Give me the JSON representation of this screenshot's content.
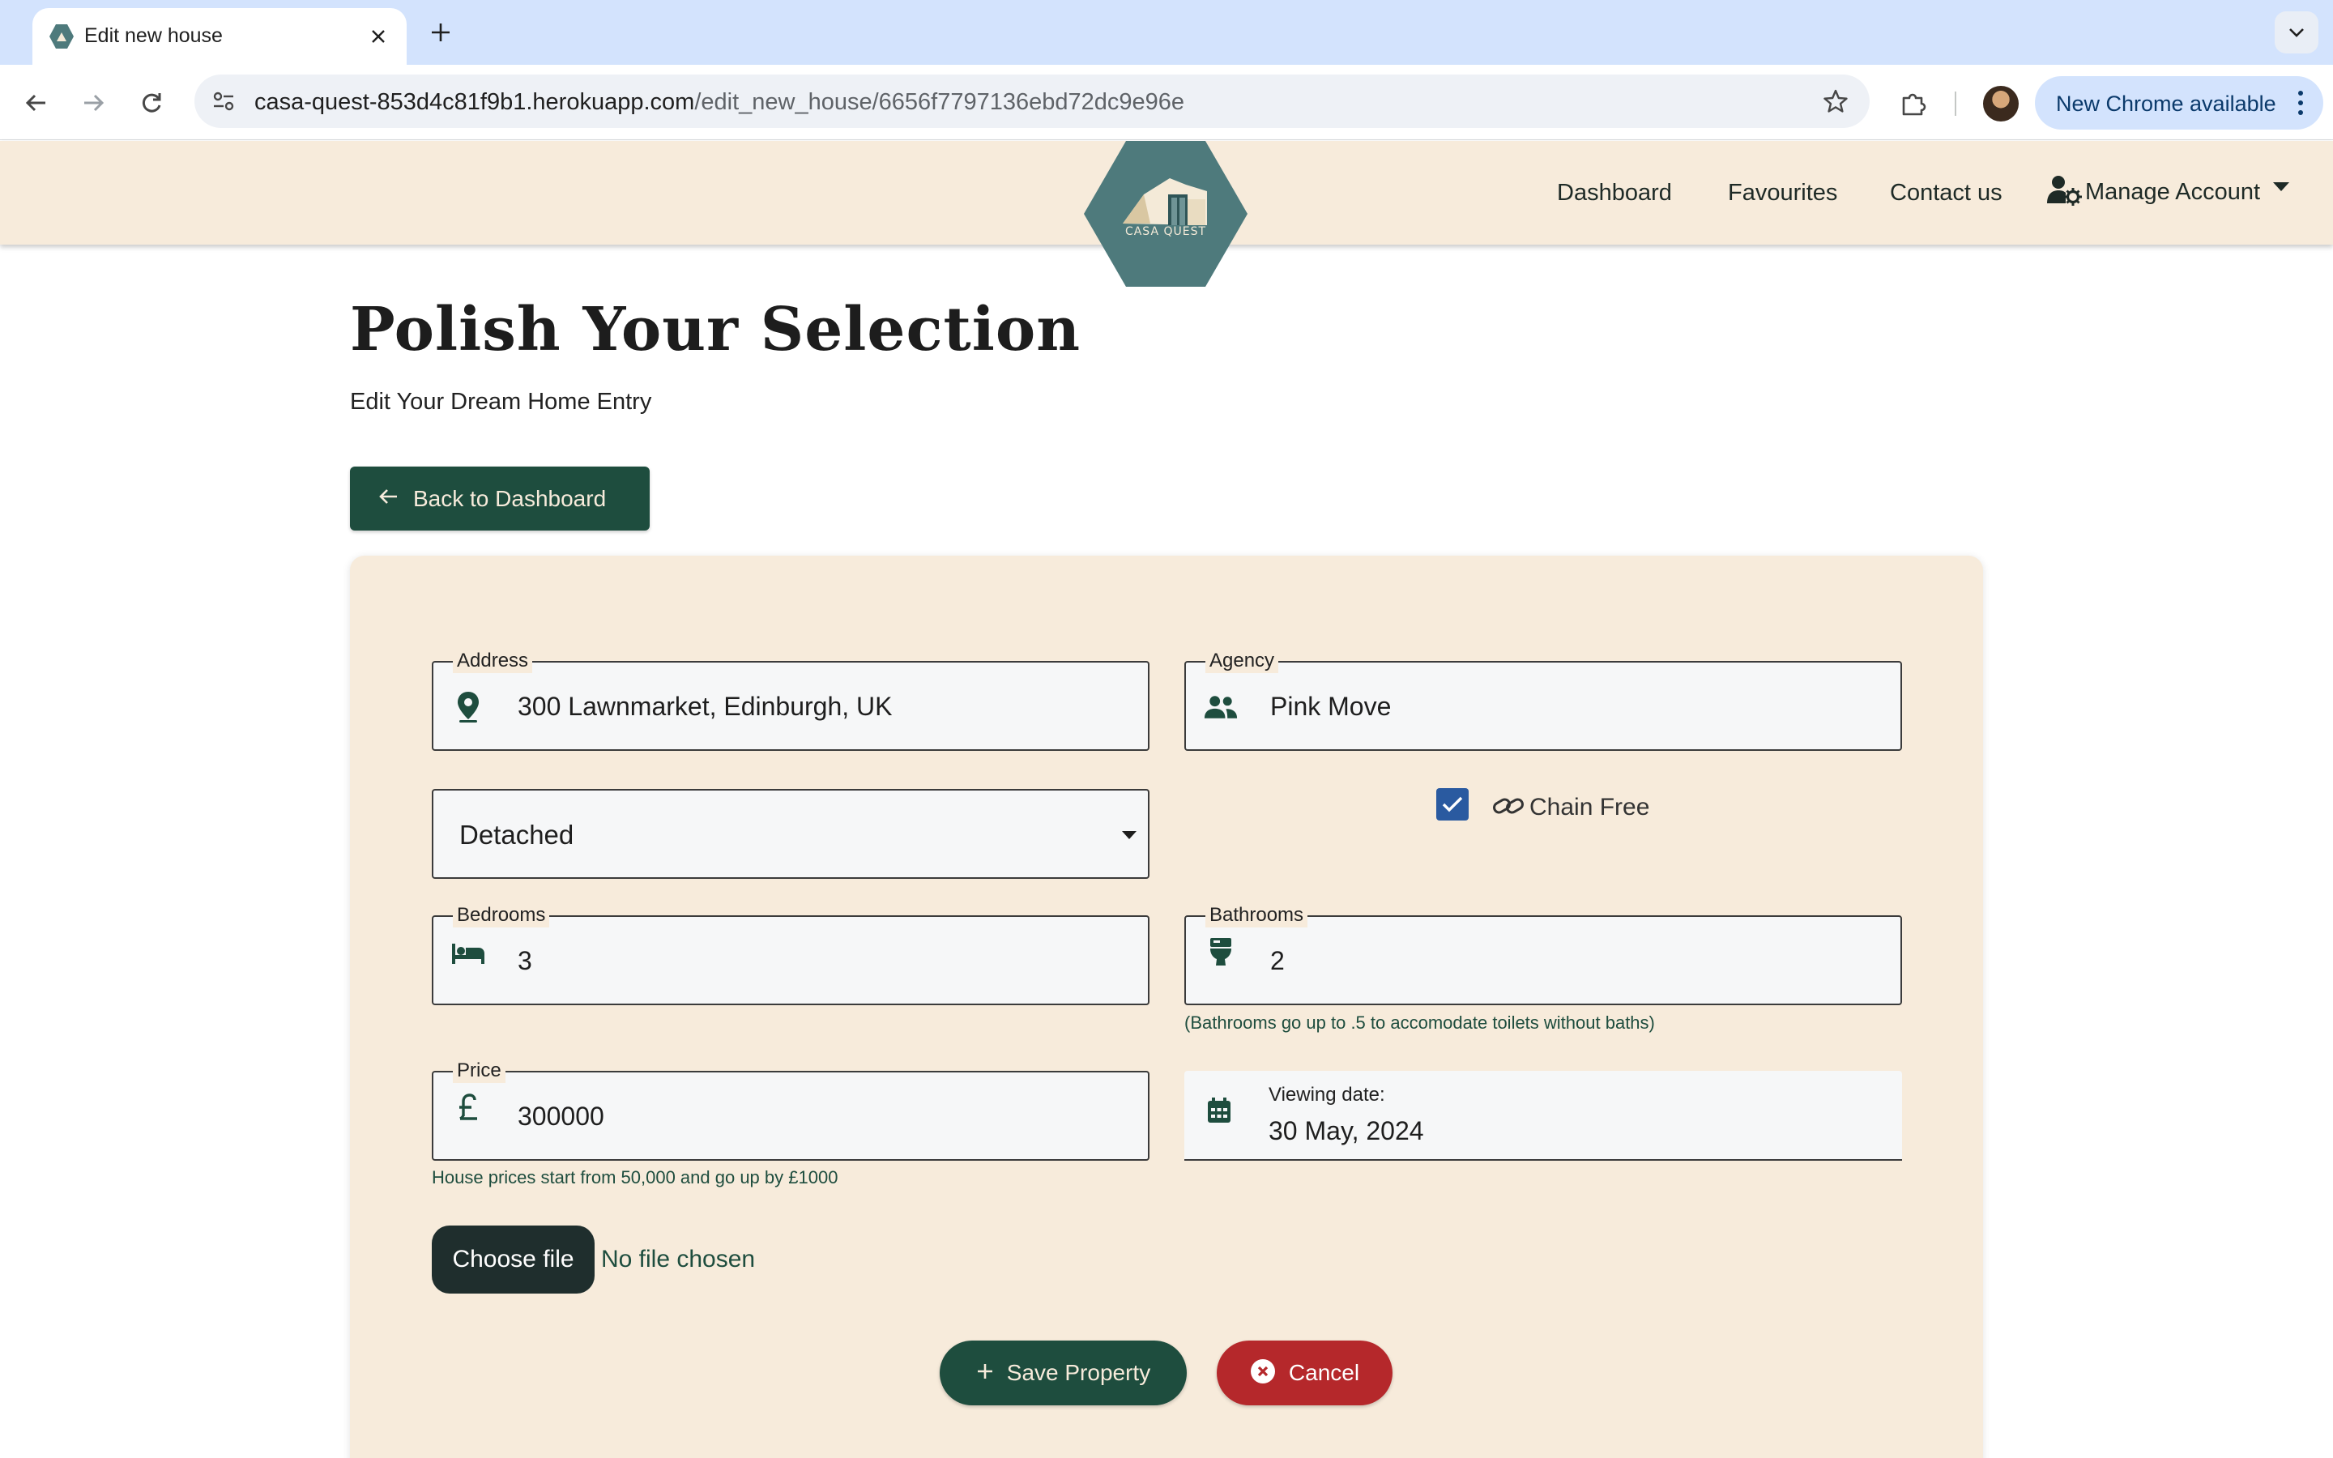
{
  "browser": {
    "tab_title": "Edit new house",
    "url_host": "casa-quest-853d4c81f9b1.herokuapp.com",
    "url_path": "/edit_new_house/6656f7797136ebd72dc9e96e",
    "update_label": "New Chrome available"
  },
  "header": {
    "logo_text": "CASA QUEST",
    "nav": {
      "dashboard": "Dashboard",
      "favourites": "Favourites",
      "contact": "Contact us",
      "manage_account": "Manage Account"
    }
  },
  "page": {
    "title": "Polish Your Selection",
    "subtitle": "Edit Your Dream Home Entry",
    "back_label": "Back to Dashboard"
  },
  "form": {
    "address": {
      "label": "Address",
      "value": "300 Lawnmarket, Edinburgh, UK"
    },
    "agency": {
      "label": "Agency",
      "value": "Pink Move"
    },
    "property_type": {
      "value": "Detached"
    },
    "chain_free": {
      "label": "Chain Free",
      "checked": true
    },
    "bedrooms": {
      "label": "Bedrooms",
      "value": "3"
    },
    "bathrooms": {
      "label": "Bathrooms",
      "value": "2",
      "helper": "(Bathrooms go up to .5 to accomodate toilets without baths)"
    },
    "price": {
      "label": "Price",
      "value": "300000",
      "helper": "House prices start from 50,000 and go up by £1000"
    },
    "viewing_date": {
      "label": "Viewing date:",
      "value": "30 May, 2024"
    },
    "file": {
      "button_label": "Choose file",
      "status": "No file chosen"
    },
    "save_label": "Save Property",
    "cancel_label": "Cancel"
  },
  "icons": {
    "address": "location-pin-icon",
    "agency": "people-icon",
    "bedrooms": "bed-icon",
    "bathrooms": "toilet-icon",
    "price": "pound-icon",
    "viewing_date": "calendar-icon",
    "chain_free": "link-icon"
  },
  "colors": {
    "brand_green": "#1e4d3e",
    "header_bg": "#f7ebdb",
    "logo_teal": "#4e7a7c",
    "cancel_red": "#b5282b",
    "checkbox_blue": "#2a5aa0",
    "browser_tab_strip": "#d3e3fd"
  }
}
